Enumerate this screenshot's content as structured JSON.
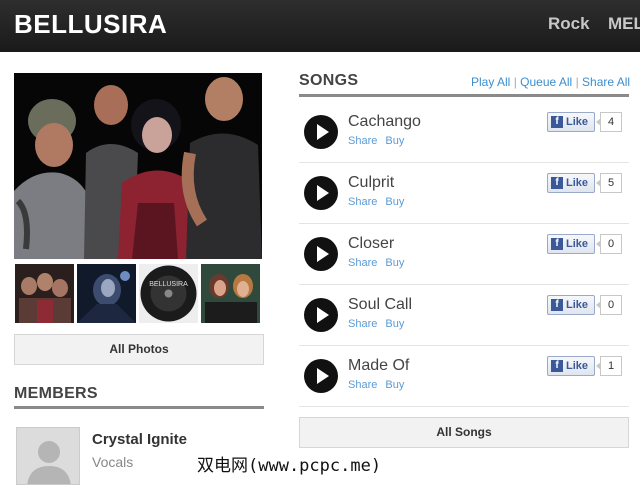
{
  "header": {
    "brand": "BELLUSIRA",
    "nav": [
      "Rock",
      "MEL"
    ]
  },
  "photos": {
    "all_photos_label": "All Photos",
    "thumb3_text": "BELLUSIRA"
  },
  "members": {
    "heading": "MEMBERS",
    "items": [
      {
        "name": "Crystal Ignite",
        "role": "Vocals"
      }
    ]
  },
  "songs": {
    "heading": "SONGS",
    "play_all": "Play All",
    "queue_all": "Queue All",
    "share_all": "Share All",
    "separator": "|",
    "share_label": "Share",
    "buy_label": "Buy",
    "like_label": "Like",
    "fb_letter": "f",
    "items": [
      {
        "title": "Cachango",
        "likes": "4"
      },
      {
        "title": "Culprit",
        "likes": "5"
      },
      {
        "title": "Closer",
        "likes": "0"
      },
      {
        "title": "Soul Call",
        "likes": "0"
      },
      {
        "title": "Made Of",
        "likes": "1"
      }
    ],
    "all_songs_label": "All Songs"
  },
  "watermark": "双电网(www.pcpc.me)"
}
